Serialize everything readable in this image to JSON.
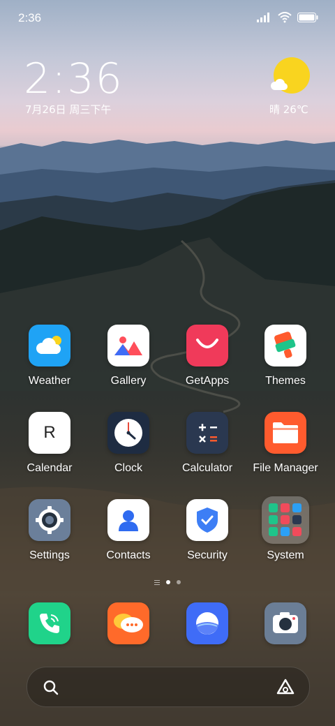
{
  "status_bar": {
    "time": "2:36",
    "icons": [
      "signal-icon",
      "wifi-icon",
      "battery-icon"
    ]
  },
  "clock_widget": {
    "time": "2:36",
    "date": "7月26日 周三下午"
  },
  "weather_widget": {
    "text": "晴 26℃",
    "icon": "sunny-cloud-icon"
  },
  "apps": [
    {
      "label": "Weather",
      "icon": "weather-icon",
      "bg": "#1fa3f5"
    },
    {
      "label": "Gallery",
      "icon": "gallery-icon",
      "bg": "#ffffff"
    },
    {
      "label": "GetApps",
      "icon": "getapps-icon",
      "bg": "#f03a5a"
    },
    {
      "label": "Themes",
      "icon": "themes-icon",
      "bg": "#ffffff"
    },
    {
      "label": "Calendar",
      "icon": "calendar-icon",
      "bg": "#ffffff",
      "glyph": "R"
    },
    {
      "label": "Clock",
      "icon": "clock-icon",
      "bg": "#1e2c42"
    },
    {
      "label": "Calculator",
      "icon": "calculator-icon",
      "bg": "#2a3850"
    },
    {
      "label": "File Manager",
      "icon": "folder-icon",
      "bg": "#ff5b2e"
    },
    {
      "label": "Settings",
      "icon": "gear-icon",
      "bg": "#6b7f9a"
    },
    {
      "label": "Contacts",
      "icon": "contact-icon",
      "bg": "#ffffff"
    },
    {
      "label": "Security",
      "icon": "shield-icon",
      "bg": "#ffffff"
    },
    {
      "label": "System",
      "icon": "folder-system-icon",
      "bg": "rgba(200,200,200,0.35)"
    }
  ],
  "dock": [
    {
      "name": "phone",
      "icon": "phone-icon",
      "bg": "#20d38a"
    },
    {
      "name": "messages",
      "icon": "message-icon",
      "bg": "#ff6a2a"
    },
    {
      "name": "browser",
      "icon": "browser-icon",
      "bg": "#3f6cf7"
    },
    {
      "name": "camera",
      "icon": "camera-icon",
      "bg": "#6b7e96"
    }
  ],
  "page_indicator": {
    "pages": 2,
    "active": 0
  },
  "search": {
    "icon": "search-icon",
    "assistant_icon": "assistant-icon"
  }
}
